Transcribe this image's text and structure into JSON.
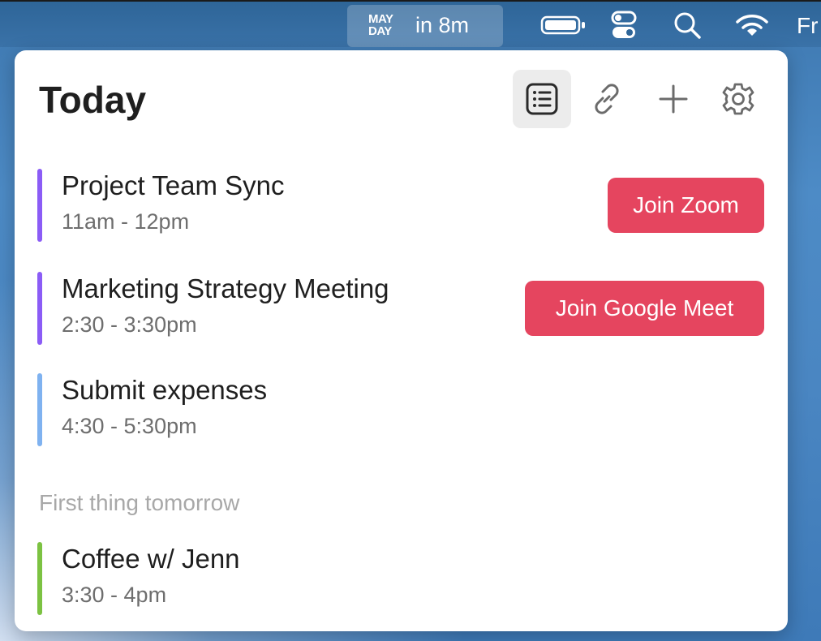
{
  "menubar": {
    "mayday_logo_line1": "MAY",
    "mayday_logo_line2": "DAY",
    "mayday_status": "in 8m",
    "clock_partial": "Fr",
    "icons": [
      "battery-icon",
      "control-center-icon",
      "spotlight-search-icon",
      "wifi-icon"
    ]
  },
  "popover": {
    "title": "Today",
    "toolbar": {
      "list_view": "list-view-icon",
      "link": "link-icon",
      "add": "plus-icon",
      "settings": "gear-icon"
    },
    "today_events": [
      {
        "name": "Project Team Sync",
        "time": "11am - 12pm",
        "color": "#8b5cf6",
        "action": "Join Zoom"
      },
      {
        "name": "Marketing Strategy Meeting",
        "time": "2:30 - 3:30pm",
        "color": "#8b5cf6",
        "action": "Join Google Meet"
      },
      {
        "name": "Submit expenses",
        "time": "4:30 - 5:30pm",
        "color": "#7fb2f0",
        "action": ""
      }
    ],
    "tomorrow_label": "First thing tomorrow",
    "tomorrow_events": [
      {
        "name": "Coffee w/ Jenn",
        "time": "3:30 - 4pm",
        "color": "#7cc242"
      }
    ]
  },
  "colors": {
    "accent_button": "#e5455f",
    "wallpaper": "#4a86c2"
  }
}
